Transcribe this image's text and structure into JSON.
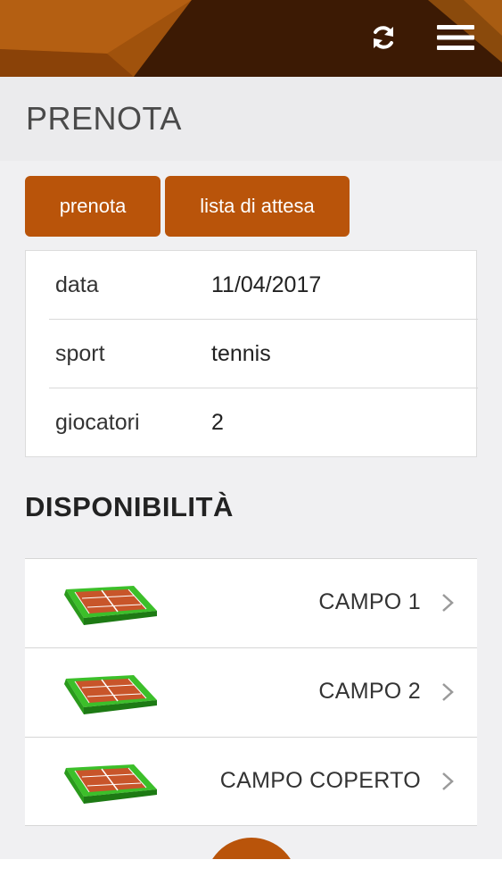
{
  "header": {
    "refresh_icon": "refresh-icon",
    "menu_icon": "hamburger-menu-icon"
  },
  "page": {
    "title": "PRENOTA"
  },
  "tabs": [
    {
      "label": "prenota"
    },
    {
      "label": "lista di attesa"
    }
  ],
  "details": [
    {
      "label": "data",
      "value": "11/04/2017"
    },
    {
      "label": "sport",
      "value": "tennis"
    },
    {
      "label": "giocatori",
      "value": "2"
    }
  ],
  "availability": {
    "title": "DISPONIBILITÀ",
    "courts": [
      {
        "name": "CAMPO 1",
        "icon": "tennis-court-icon"
      },
      {
        "name": "CAMPO 2",
        "icon": "tennis-court-icon"
      },
      {
        "name": "CAMPO COPERTO",
        "icon": "tennis-court-icon"
      }
    ]
  },
  "colors": {
    "accent": "#b9540a",
    "header_dark": "#3f1d05",
    "header_light": "#9a4a0a"
  }
}
